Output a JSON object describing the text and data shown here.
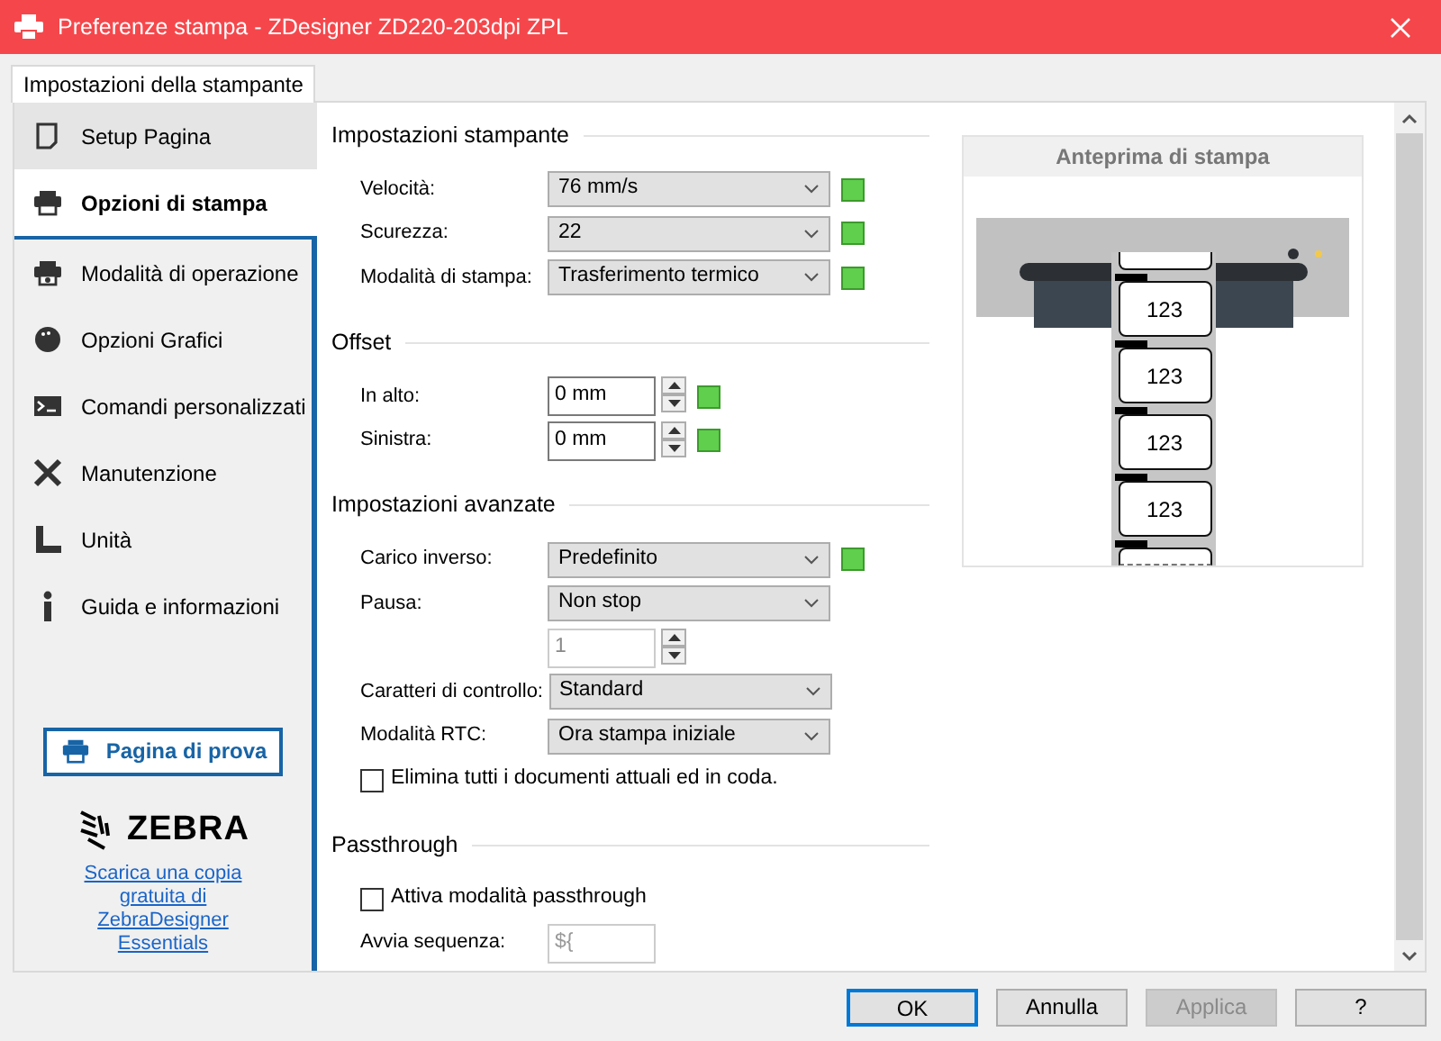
{
  "window": {
    "title": "Preferenze stampa - ZDesigner ZD220-203dpi ZPL"
  },
  "tabs": [
    {
      "label": "Impostazioni della stampante",
      "selected": true
    }
  ],
  "sidebar": {
    "items": [
      {
        "label": "Setup Pagina",
        "selected": false
      },
      {
        "label": "Opzioni di stampa",
        "selected": true
      },
      {
        "label": "Modalità di operazione",
        "selected": false
      },
      {
        "label": "Opzioni Grafici",
        "selected": false
      },
      {
        "label": "Comandi personalizzati",
        "selected": false
      },
      {
        "label": "Manutenzione",
        "selected": false
      },
      {
        "label": "Unità",
        "selected": false
      },
      {
        "label": "Guida e informazioni",
        "selected": false
      }
    ],
    "test_button": "Pagina di prova",
    "logo": "ZEBRA",
    "link": "Scarica una copia gratuita di ZebraDesigner Essentials"
  },
  "sections": [
    {
      "title": "Impostazioni stampante",
      "rows": [
        {
          "kind": "select",
          "label": "Velocità:",
          "value": "76 mm/s",
          "indicator": true
        },
        {
          "kind": "select",
          "label": "Scurezza:",
          "value": "22",
          "indicator": true
        },
        {
          "kind": "select",
          "label": "Modalità di stampa:",
          "value": "Trasferimento termico",
          "indicator": true
        }
      ]
    },
    {
      "title": "Offset",
      "rows": [
        {
          "kind": "spin",
          "label": "In alto:",
          "value": "0 mm",
          "indicator": true,
          "disabled": false
        },
        {
          "kind": "spin",
          "label": "Sinistra:",
          "value": "0 mm",
          "indicator": true,
          "disabled": false
        }
      ]
    },
    {
      "title": "Impostazioni avanzate",
      "rows": [
        {
          "kind": "select",
          "label": "Carico inverso:",
          "value": "Predefinito",
          "indicator": true
        },
        {
          "kind": "select",
          "label": "Pausa:",
          "value": "Non stop",
          "indicator": false
        },
        {
          "kind": "spin",
          "value": "1",
          "indicator": false,
          "disabled": true
        },
        {
          "kind": "select",
          "label": "Caratteri di controllo:",
          "value": "Standard",
          "indicator": false
        },
        {
          "kind": "select",
          "label": "Modalità RTC:",
          "value": "Ora stampa iniziale",
          "indicator": false
        },
        {
          "kind": "check",
          "label": "Elimina tutti i documenti attuali ed in coda.",
          "checked": false
        }
      ]
    },
    {
      "title": "Passthrough",
      "rows": [
        {
          "kind": "check",
          "label": "Attiva modalità passthrough",
          "checked": false
        },
        {
          "kind": "text",
          "label": "Avvia sequenza:",
          "value": "${",
          "disabled": true
        }
      ]
    }
  ],
  "preview": {
    "title": "Anteprima di stampa",
    "labels": [
      "123",
      "123",
      "123",
      "123"
    ]
  },
  "buttons": [
    {
      "label": "OK",
      "default": true,
      "disabled": false
    },
    {
      "label": "Annulla",
      "default": false,
      "disabled": false
    },
    {
      "label": "Applica",
      "default": false,
      "disabled": true
    },
    {
      "label": "?",
      "default": false,
      "disabled": false
    }
  ]
}
